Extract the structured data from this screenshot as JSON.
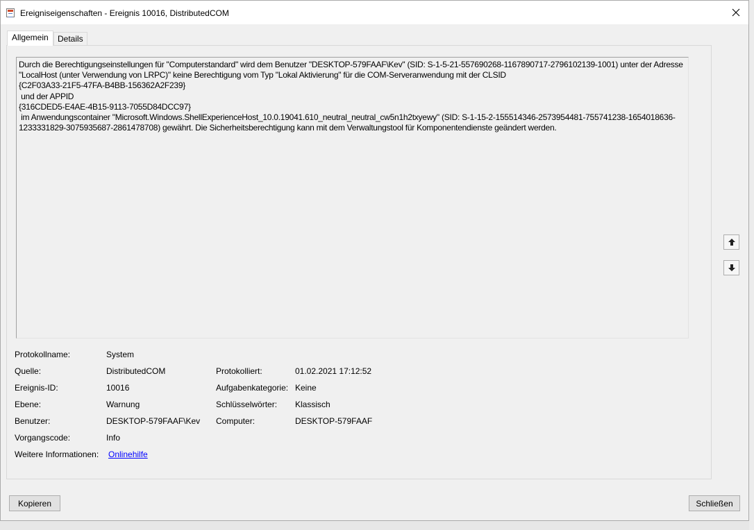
{
  "window": {
    "title": "Ereigniseigenschaften - Ereignis 10016, DistributedCOM",
    "icon": "event-viewer-icon"
  },
  "tabs": [
    {
      "label": "Allgemein",
      "active": true
    },
    {
      "label": "Details",
      "active": false
    }
  ],
  "description": "Durch die Berechtigungseinstellungen für \"Computerstandard\" wird dem Benutzer \"DESKTOP-579FAAF\\Kev\" (SID: S-1-5-21-557690268-1167890717-2796102139-1001) unter der Adresse \"LocalHost (unter Verwendung von LRPC)\" keine Berechtigung vom Typ \"Lokal Aktivierung\" für die COM-Serveranwendung mit der CLSID\n{C2F03A33-21F5-47FA-B4BB-156362A2F239}\n und der APPID\n{316CDED5-E4AE-4B15-9113-7055D84DCC97}\n im Anwendungscontainer \"Microsoft.Windows.ShellExperienceHost_10.0.19041.610_neutral_neutral_cw5n1h2txyewy\" (SID: S-1-15-2-155514346-2573954481-755741238-1654018636-1233331829-3075935687-2861478708) gewährt. Die Sicherheitsberechtigung kann mit dem Verwaltungstool für Komponentendienste geändert werden.",
  "scroll_buttons": {
    "up": "arrow-up-icon",
    "down": "arrow-down-icon"
  },
  "fields": {
    "protokollname": {
      "label": "Protokollname:",
      "value": "System"
    },
    "quelle": {
      "label": "Quelle:",
      "value": "DistributedCOM"
    },
    "protokolliert": {
      "label": "Protokolliert:",
      "value": "01.02.2021 17:12:52"
    },
    "ereignis_id": {
      "label": "Ereignis-ID:",
      "value": "10016"
    },
    "aufgabenkategorie": {
      "label": "Aufgabenkategorie:",
      "value": "Keine"
    },
    "ebene": {
      "label": "Ebene:",
      "value": "Warnung"
    },
    "schluesselwoerter": {
      "label": "Schlüsselwörter:",
      "value": "Klassisch"
    },
    "benutzer": {
      "label": "Benutzer:",
      "value": "DESKTOP-579FAAF\\Kev"
    },
    "computer": {
      "label": "Computer:",
      "value": "DESKTOP-579FAAF"
    },
    "vorgangscode": {
      "label": "Vorgangscode:",
      "value": "Info"
    },
    "weitere_informationen": {
      "label": "Weitere Informationen:",
      "value": "Onlinehilfe"
    }
  },
  "buttons": {
    "copy": "Kopieren",
    "close": "Schließen"
  },
  "colors": {
    "link": "#0000ff",
    "title_bar": "#ffffff",
    "window_bg": "#f0f0f0"
  }
}
